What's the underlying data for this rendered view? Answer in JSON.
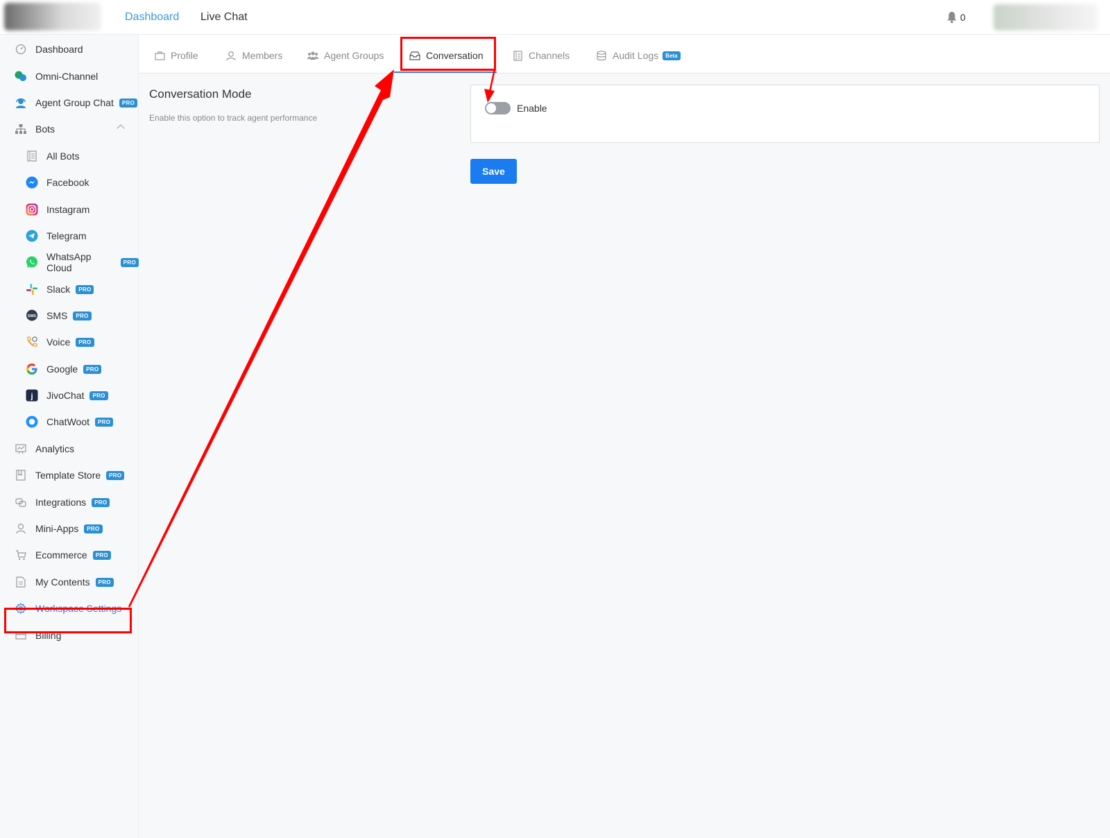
{
  "topbar": {
    "nav": [
      "Dashboard",
      "Live Chat"
    ],
    "notification_count": "0",
    "colors": {
      "active_nav": "#3a9ad9"
    }
  },
  "sidebar": {
    "items": [
      {
        "label": "Dashboard",
        "icon": "dashboard-gauge-icon",
        "pro": false
      },
      {
        "label": "Omni-Channel",
        "icon": "omni-channel-chat-icon",
        "pro": false
      },
      {
        "label": "Agent Group Chat",
        "icon": "agent-headset-icon",
        "pro": true
      },
      {
        "label": "Bots",
        "icon": "sitemap-icon",
        "pro": false
      },
      {
        "label": "All Bots",
        "icon": "list-page-icon",
        "pro": false
      },
      {
        "label": "Facebook",
        "icon": "messenger-icon",
        "pro": false
      },
      {
        "label": "Instagram",
        "icon": "instagram-icon",
        "pro": false
      },
      {
        "label": "Telegram",
        "icon": "telegram-icon",
        "pro": false
      },
      {
        "label": "WhatsApp Cloud",
        "icon": "whatsapp-icon",
        "pro": true
      },
      {
        "label": "Slack",
        "icon": "slack-icon",
        "pro": true
      },
      {
        "label": "SMS",
        "icon": "sms-bubble-icon",
        "pro": true
      },
      {
        "label": "Voice",
        "icon": "phone-icon",
        "pro": true
      },
      {
        "label": "Google",
        "icon": "google-icon",
        "pro": true
      },
      {
        "label": "JivoChat",
        "icon": "jivochat-icon",
        "pro": true
      },
      {
        "label": "ChatWoot",
        "icon": "chatwoot-icon",
        "pro": true
      },
      {
        "label": "Analytics",
        "icon": "analytics-chart-icon",
        "pro": false
      },
      {
        "label": "Template Store",
        "icon": "template-book-icon",
        "pro": true
      },
      {
        "label": "Integrations",
        "icon": "integrations-link-icon",
        "pro": true
      },
      {
        "label": "Mini-Apps",
        "icon": "user-outline-icon",
        "pro": true
      },
      {
        "label": "Ecommerce",
        "icon": "cart-icon",
        "pro": true
      },
      {
        "label": "My Contents",
        "icon": "document-icon",
        "pro": true
      },
      {
        "label": "Workspace Settings",
        "icon": "gear-icon",
        "pro": false,
        "active": true
      },
      {
        "label": "Billing",
        "icon": "credit-card-icon",
        "pro": false
      }
    ],
    "pro_label": "PRO"
  },
  "tabs": [
    {
      "label": "Profile",
      "icon": "briefcase-icon"
    },
    {
      "label": "Members",
      "icon": "user-icon"
    },
    {
      "label": "Agent Groups",
      "icon": "users-icon"
    },
    {
      "label": "Conversation",
      "icon": "inbox-icon",
      "active": true
    },
    {
      "label": "Channels",
      "icon": "list-icon"
    },
    {
      "label": "Audit Logs",
      "icon": "database-icon",
      "badge": "Beta"
    }
  ],
  "conversation": {
    "title": "Conversation Mode",
    "description": "Enable this option to track agent performance",
    "toggle_label": "Enable",
    "toggle_on": false,
    "save_label": "Save"
  },
  "colors": {
    "primary_button": "#1a7cf0",
    "pro_badge": "#2a8fd4",
    "annotation": "#ff0000"
  }
}
